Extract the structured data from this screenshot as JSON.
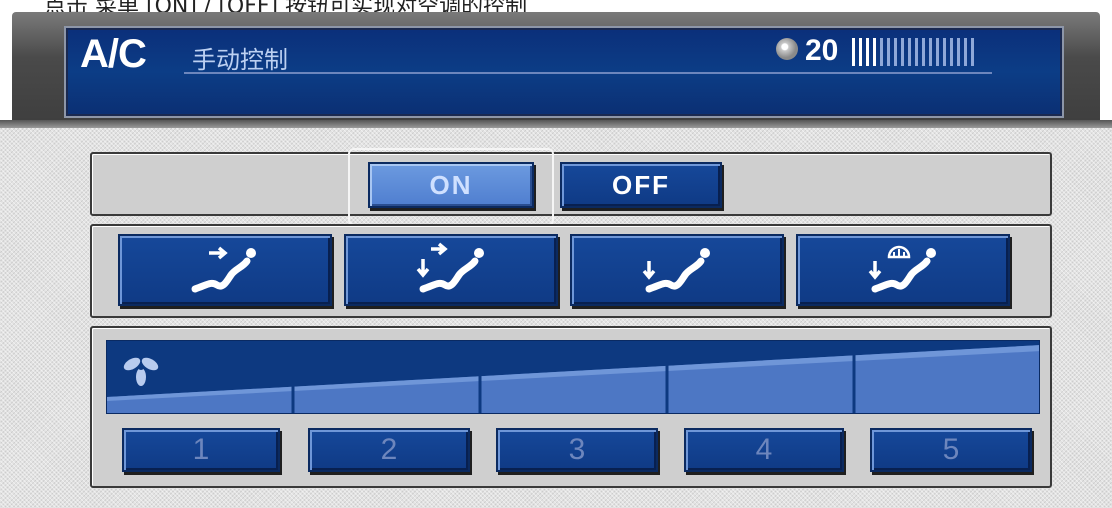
{
  "caption": {
    "text": "点击 菜单 [ON] / [OFF] 按钮可实现对空调的控制"
  },
  "header": {
    "title": "A/C",
    "subtitle": "手动控制",
    "icon": "disc-icon",
    "volume_value": "20",
    "volume_level": 0.2
  },
  "power": {
    "on_label": "ON",
    "off_label": "OFF",
    "selected": "ON"
  },
  "airflow_modes": [
    {
      "icon": "face-vent-icon"
    },
    {
      "icon": "bilevel-vent-icon"
    },
    {
      "icon": "foot-vent-icon"
    },
    {
      "icon": "foot-defrost-vent-icon"
    }
  ],
  "fan": {
    "icon": "fan-icon",
    "current_speed": 5,
    "levels": [
      "1",
      "2",
      "3",
      "4",
      "5"
    ]
  },
  "colors": {
    "accent_blue": "#0f3a85",
    "selected_blue": "#5a88d6",
    "header_blue": "#0c3d86"
  }
}
